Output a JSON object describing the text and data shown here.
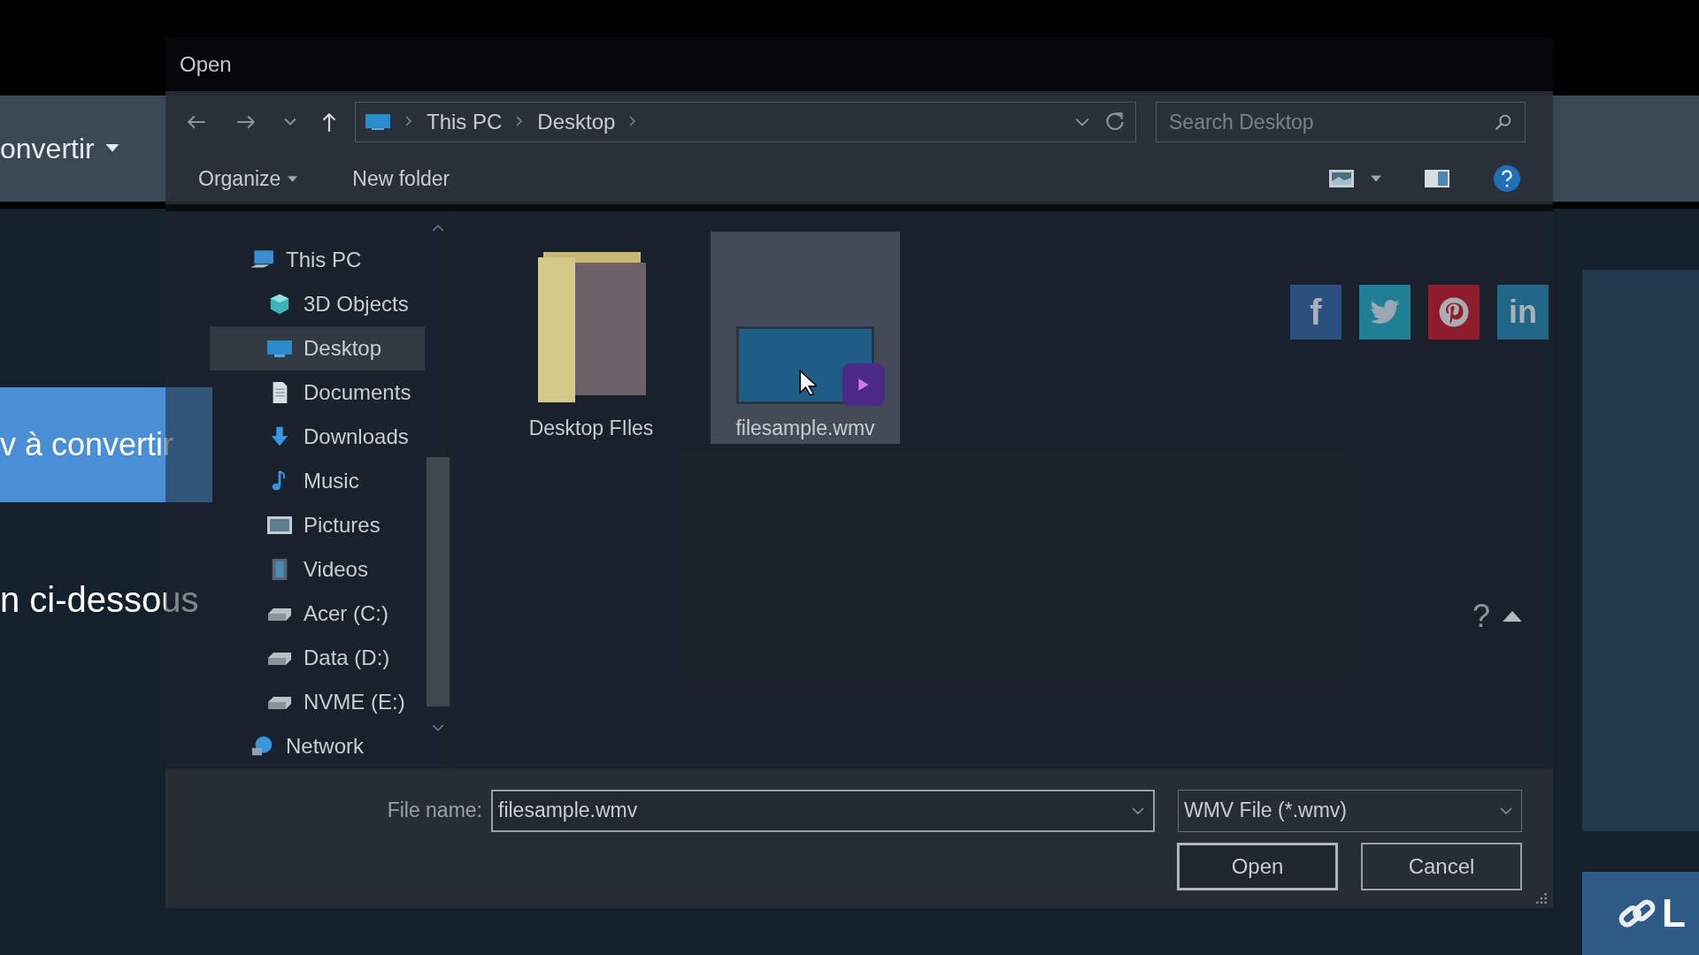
{
  "page": {
    "menu_label": "onvertir",
    "upload_button": "v à convertir",
    "heading": "n ci-dessous",
    "link_button": "L",
    "social": [
      {
        "kind": "facebook",
        "glyph": "f",
        "color": "#2b4f7e"
      },
      {
        "kind": "twitter",
        "color": "#1f7f95"
      },
      {
        "kind": "pinterest",
        "color": "#8e1c2b"
      },
      {
        "kind": "linkedin",
        "glyph": "in",
        "color": "#1f6689"
      }
    ]
  },
  "dialog": {
    "title": "Open",
    "breadcrumb": [
      "This PC",
      "Desktop"
    ],
    "search": {
      "placeholder": "Search Desktop"
    },
    "toolbar": [
      {
        "label": "Organize",
        "dropdown": true
      },
      {
        "label": "New folder",
        "dropdown": false
      }
    ],
    "sidebar": {
      "items": [
        {
          "label": "This PC",
          "kind": "pc",
          "selected": false,
          "children": [
            {
              "label": "3D Objects",
              "kind": "cube",
              "selected": false
            },
            {
              "label": "Desktop",
              "kind": "desktop",
              "selected": true
            },
            {
              "label": "Documents",
              "kind": "document",
              "selected": false
            },
            {
              "label": "Downloads",
              "kind": "download",
              "selected": false
            },
            {
              "label": "Music",
              "kind": "music",
              "selected": false
            },
            {
              "label": "Pictures",
              "kind": "pictures",
              "selected": false
            },
            {
              "label": "Videos",
              "kind": "videos",
              "selected": false
            },
            {
              "label": "Acer (C:)",
              "kind": "drive",
              "selected": false
            },
            {
              "label": "Data (D:)",
              "kind": "drive",
              "selected": false
            },
            {
              "label": "NVME (E:)",
              "kind": "drive",
              "selected": false
            }
          ]
        },
        {
          "label": "Network",
          "kind": "network",
          "selected": false
        }
      ]
    },
    "files": [
      {
        "name": "Desktop FIles",
        "kind": "folder",
        "selected": false
      },
      {
        "name": "filesample.wmv",
        "kind": "video",
        "selected": true
      }
    ],
    "pane_help": "?",
    "file_name": {
      "label": "File name:",
      "value": "filesample.wmv"
    },
    "file_type": {
      "value": "WMV File (*.wmv)"
    },
    "buttons": [
      {
        "label": "Open",
        "kind": "primary"
      },
      {
        "label": "Cancel",
        "kind": "secondary"
      }
    ]
  }
}
